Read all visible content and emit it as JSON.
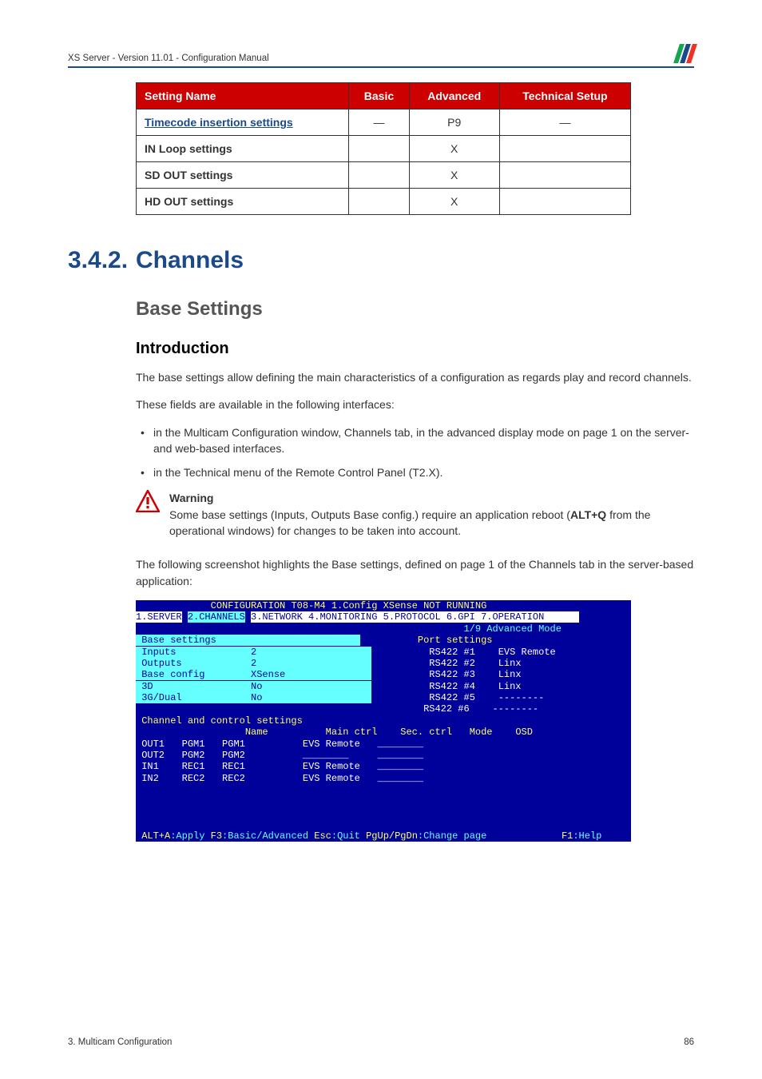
{
  "header": {
    "text": "XS Server - Version 11.01 - Configuration Manual"
  },
  "table": {
    "headers": [
      "Setting Name",
      "Basic",
      "Advanced",
      "Technical Setup"
    ],
    "rows": [
      {
        "name": "Timecode insertion settings",
        "link": true,
        "basic": "—",
        "adv": "P9",
        "tech": "—"
      },
      {
        "name": "IN Loop settings",
        "link": false,
        "basic": "",
        "adv": "X",
        "tech": ""
      },
      {
        "name": "SD OUT settings",
        "link": false,
        "basic": "",
        "adv": "X",
        "tech": ""
      },
      {
        "name": "HD OUT settings",
        "link": false,
        "basic": "",
        "adv": "X",
        "tech": ""
      }
    ]
  },
  "section": {
    "num": "3.4.2.",
    "title": "Channels"
  },
  "sub": "Base Settings",
  "subsub": "Introduction",
  "para1": "The base settings allow defining the main characteristics of a configuration as regards play and record channels.",
  "para2": "These fields are available in the following interfaces:",
  "bullets": [
    "in the Multicam Configuration window, Channels tab, in the advanced display mode on page 1 on the server- and web-based interfaces.",
    "in the Technical menu of the Remote Control Panel (T2.X)."
  ],
  "warning": {
    "label": "Warning",
    "body_a": "Some base settings (Inputs, Outputs Base config.) require an application reboot (",
    "body_b": "ALT+Q",
    "body_c": " from the operational windows) for changes to be taken into account."
  },
  "para3": "The following screenshot highlights the Base settings, defined on page 1 of the Channels tab in the server-based application:",
  "terminal": {
    "title": "CONFIGURATION T08-M4 1.Config XSense NOT RUNNING",
    "tabs": "1.SERVER 2.CHANNELS 3.NETWORK 4.MONITORING 5.PROTOCOL 6.GPI 7.OPERATION",
    "mode": "1/9 Advanced Mode",
    "base_label": "Base settings",
    "base_rows": [
      [
        "Inputs",
        "2"
      ],
      [
        "Outputs",
        "2"
      ],
      [
        "Base config",
        "XSense"
      ],
      [
        "3D",
        "No"
      ],
      [
        "3G/Dual",
        "No"
      ]
    ],
    "port_label": "Port settings",
    "port_rows": [
      [
        "RS422 #1",
        "EVS Remote"
      ],
      [
        "RS422 #2",
        "Linx"
      ],
      [
        "RS422 #3",
        "Linx"
      ],
      [
        "RS422 #4",
        "Linx"
      ],
      [
        "RS422 #5",
        "--------"
      ],
      [
        "RS422 #6",
        "--------"
      ]
    ],
    "ch_label": "Channel and control settings",
    "ch_hdr": [
      "",
      "",
      "Name",
      "Main ctrl",
      "Sec. ctrl",
      "Mode",
      "OSD"
    ],
    "ch_rows": [
      [
        "OUT1",
        "PGM1",
        "PGM1",
        "EVS Remote",
        "________",
        "",
        ""
      ],
      [
        "OUT2",
        "PGM2",
        "PGM2",
        "________",
        "________",
        "",
        ""
      ],
      [
        "IN1",
        "REC1",
        "REC1",
        "EVS Remote",
        "________",
        "",
        ""
      ],
      [
        "IN2",
        "REC2",
        "REC2",
        "EVS Remote",
        "________",
        "",
        ""
      ]
    ],
    "foot": {
      "a": "ALT+A",
      "at": ":Apply ",
      "b": "F3",
      "bt": ":Basic/Advanced ",
      "c": "Esc",
      "ct": ":Quit ",
      "d": "PgUp/PgDn",
      "dt": ":Change page",
      "e": "F1",
      "et": ":Help"
    }
  },
  "footer": {
    "left": "3. Multicam Configuration",
    "right": "86"
  }
}
